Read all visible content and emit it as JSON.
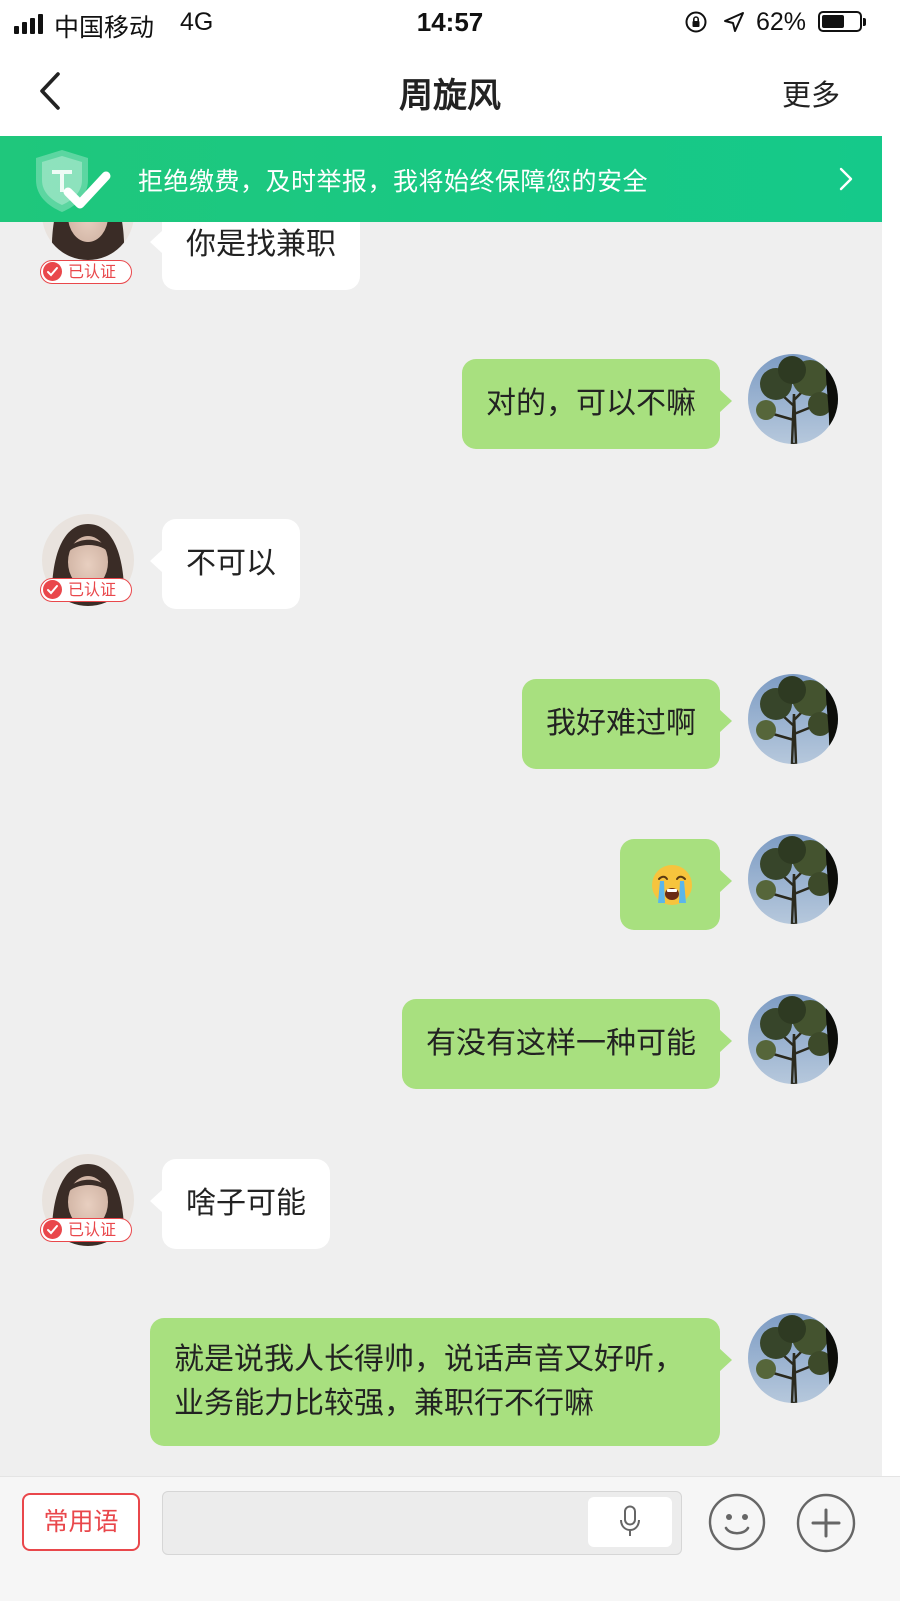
{
  "status_bar": {
    "carrier": "中国移动",
    "network": "4G",
    "time": "14:57",
    "battery": "62%",
    "battery_level": 0.62
  },
  "nav": {
    "title": "周旋风",
    "more_label": "更多"
  },
  "banner": {
    "text": "拒绝缴费，及时举报，我将始终保障您的安全"
  },
  "verified_label": "已认证",
  "messages": [
    {
      "side": "left",
      "text": "你是找兼职"
    },
    {
      "side": "right",
      "text": "对的，可以不嘛"
    },
    {
      "side": "left",
      "text": "不可以"
    },
    {
      "side": "right",
      "text": "我好难过啊"
    },
    {
      "side": "right",
      "emoji": "crying-face"
    },
    {
      "side": "right",
      "text": "有没有这样一种可能"
    },
    {
      "side": "left",
      "text": "啥子可能"
    },
    {
      "side": "right",
      "text": "就是说我人长得帅，说话声音又好听，业务能力比较强，兼职行不行嘛"
    }
  ],
  "bottom_bar": {
    "phrases_label": "常用语",
    "input_value": "",
    "icons": [
      "microphone-icon",
      "smiley-icon",
      "plus-icon"
    ]
  },
  "colors": {
    "banner": "#1fc77c",
    "my_bubble": "#a8e07f",
    "their_bubble": "#ffffff",
    "verified": "#e9474b",
    "background": "#efefef"
  }
}
